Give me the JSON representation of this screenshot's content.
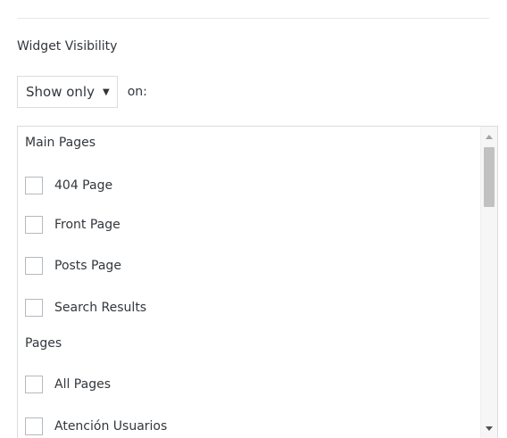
{
  "widget_visibility": {
    "heading": "Widget Visibility",
    "mode_select": {
      "value": "Show only",
      "suffix": "on:"
    }
  },
  "conditions_list": {
    "groups": [
      {
        "heading": "Main Pages",
        "options": [
          {
            "label": "404 Page",
            "checked": false
          },
          {
            "label": "Front Page",
            "checked": false
          },
          {
            "label": "Posts Page",
            "checked": false
          },
          {
            "label": "Search Results",
            "checked": false
          }
        ]
      },
      {
        "heading": "Pages",
        "options": [
          {
            "label": "All Pages",
            "checked": false
          },
          {
            "label": "Atención Usuarios",
            "checked": false
          }
        ]
      }
    ]
  }
}
